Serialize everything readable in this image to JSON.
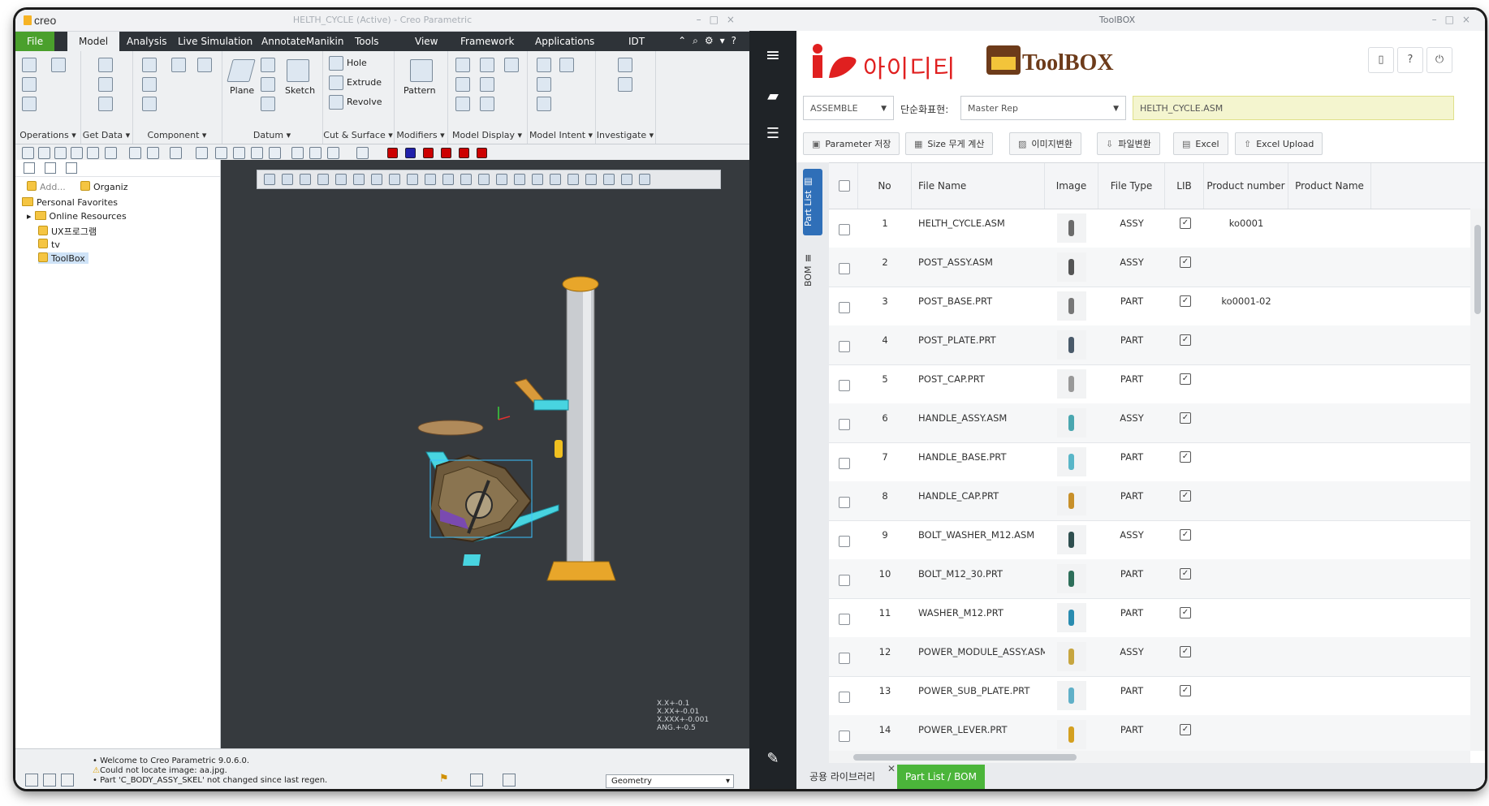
{
  "creo": {
    "logo": "creo",
    "window_title": "HELTH_CYCLE (Active) - Creo Parametric",
    "tabs": [
      "File",
      "Model",
      "Analysis",
      "Live Simulation",
      "AnnotateManikin",
      "Tools",
      "View",
      "Framework",
      "Applications",
      "IDT"
    ],
    "ribbon_groups": [
      "Operations ▾",
      "Get Data ▾",
      "Component ▾",
      "Datum ▾",
      "Cut & Surface ▾",
      "Modifiers ▾",
      "Model Display ▾",
      "Model Intent ▾",
      "Investigate ▾"
    ],
    "ribbon_labels": {
      "plane": "Plane",
      "sketch": "Sketch",
      "hole": "Hole",
      "extrude": "Extrude",
      "revolve": "Revolve",
      "pattern": "Pattern"
    },
    "tree_toolbar": {
      "add": "Add...",
      "organize": "Organiz"
    },
    "tree": [
      "Personal Favorites",
      "Online Resources",
      "UX프로그램",
      "tv",
      "ToolBox"
    ],
    "tolerance": [
      "X.X+-0.1",
      "X.XX+-0.01",
      "X.XXX+-0.001",
      "ANG.+-0.5"
    ],
    "messages": [
      "Welcome to Creo Parametric 9.0.6.0.",
      "Could not locate image: aa.jpg.",
      "Part 'C_BODY_ASSY_SKEL' not changed since last regen."
    ],
    "filter": "Geometry"
  },
  "toolbox": {
    "window_title": "ToolBOX",
    "brand_korean": "아이디티",
    "brand_name": "ToolBOX",
    "mode_select": "ASSEMBLE",
    "simplified_label": "단순화표현:",
    "simplified_select": "Master Rep",
    "file_field": "HELTH_CYCLE.ASM",
    "buttons": [
      "Parameter 저장",
      "Size 무게 계산",
      "이미지변환",
      "파일변환",
      "Excel",
      "Excel Upload"
    ],
    "side_tabs": [
      "Part List",
      "BOM"
    ],
    "columns": [
      "No",
      "File Name",
      "Image",
      "File Type",
      "LIB",
      "Product number",
      "Product Name"
    ],
    "rows": [
      {
        "no": "1",
        "file": "HELTH_CYCLE.ASM",
        "type": "ASSY",
        "pn": "ko0001"
      },
      {
        "no": "2",
        "file": "POST_ASSY.ASM",
        "type": "ASSY",
        "pn": ""
      },
      {
        "no": "3",
        "file": "POST_BASE.PRT",
        "type": "PART",
        "pn": "ko0001-02"
      },
      {
        "no": "4",
        "file": "POST_PLATE.PRT",
        "type": "PART",
        "pn": ""
      },
      {
        "no": "5",
        "file": "POST_CAP.PRT",
        "type": "PART",
        "pn": ""
      },
      {
        "no": "6",
        "file": "HANDLE_ASSY.ASM",
        "type": "ASSY",
        "pn": ""
      },
      {
        "no": "7",
        "file": "HANDLE_BASE.PRT",
        "type": "PART",
        "pn": ""
      },
      {
        "no": "8",
        "file": "HANDLE_CAP.PRT",
        "type": "PART",
        "pn": ""
      },
      {
        "no": "9",
        "file": "BOLT_WASHER_M12.ASM",
        "type": "ASSY",
        "pn": ""
      },
      {
        "no": "10",
        "file": "BOLT_M12_30.PRT",
        "type": "PART",
        "pn": ""
      },
      {
        "no": "11",
        "file": "WASHER_M12.PRT",
        "type": "PART",
        "pn": ""
      },
      {
        "no": "12",
        "file": "POWER_MODULE_ASSY.ASM",
        "type": "ASSY",
        "pn": ""
      },
      {
        "no": "13",
        "file": "POWER_SUB_PLATE.PRT",
        "type": "PART",
        "pn": ""
      },
      {
        "no": "14",
        "file": "POWER_LEVER.PRT",
        "type": "PART",
        "pn": ""
      }
    ],
    "thumb_colors": [
      "#6b6b6b",
      "#555555",
      "#777777",
      "#4a5a6a",
      "#999999",
      "#4aa7b0",
      "#59b6c8",
      "#c8902a",
      "#2f4f4f",
      "#2e6f5a",
      "#2a8cb0",
      "#c7a640",
      "#60b0c8",
      "#d4a020"
    ],
    "bottom_tabs": [
      "공용 라이브러리",
      "Part List / BOM"
    ]
  }
}
